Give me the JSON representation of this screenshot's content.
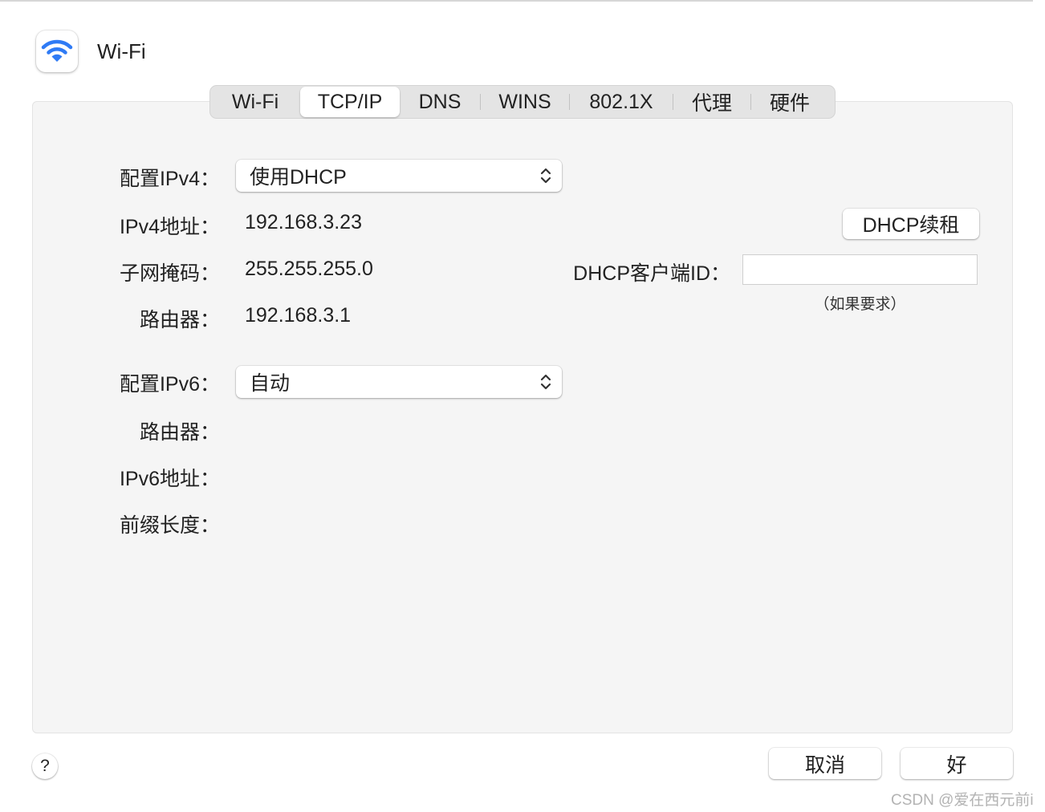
{
  "window": {
    "title": "Wi-Fi",
    "icon": "wifi-icon",
    "accent": "#2f7bf5"
  },
  "tabs": [
    {
      "label": "Wi-Fi",
      "active": false
    },
    {
      "label": "TCP/IP",
      "active": true
    },
    {
      "label": "DNS",
      "active": false
    },
    {
      "label": "WINS",
      "active": false
    },
    {
      "label": "802.1X",
      "active": false
    },
    {
      "label": "代理",
      "active": false
    },
    {
      "label": "硬件",
      "active": false
    }
  ],
  "ipv4": {
    "configure_label": "配置IPv4：",
    "configure_value": "使用DHCP",
    "address_label": "IPv4地址：",
    "address_value": "192.168.3.23",
    "subnet_label": "子网掩码：",
    "subnet_value": "255.255.255.0",
    "router_label": "路由器：",
    "router_value": "192.168.3.1",
    "renew_button": "DHCP续租",
    "client_id_label": "DHCP客户端ID：",
    "client_id_value": "",
    "client_id_hint": "（如果要求）"
  },
  "ipv6": {
    "configure_label": "配置IPv6：",
    "configure_value": "自动",
    "router_label": "路由器：",
    "address_label": "IPv6地址：",
    "prefix_label": "前缀长度："
  },
  "footer": {
    "help_label": "?",
    "cancel_button": "取消",
    "ok_button": "好"
  },
  "watermark": "CSDN @爱在西元前i"
}
